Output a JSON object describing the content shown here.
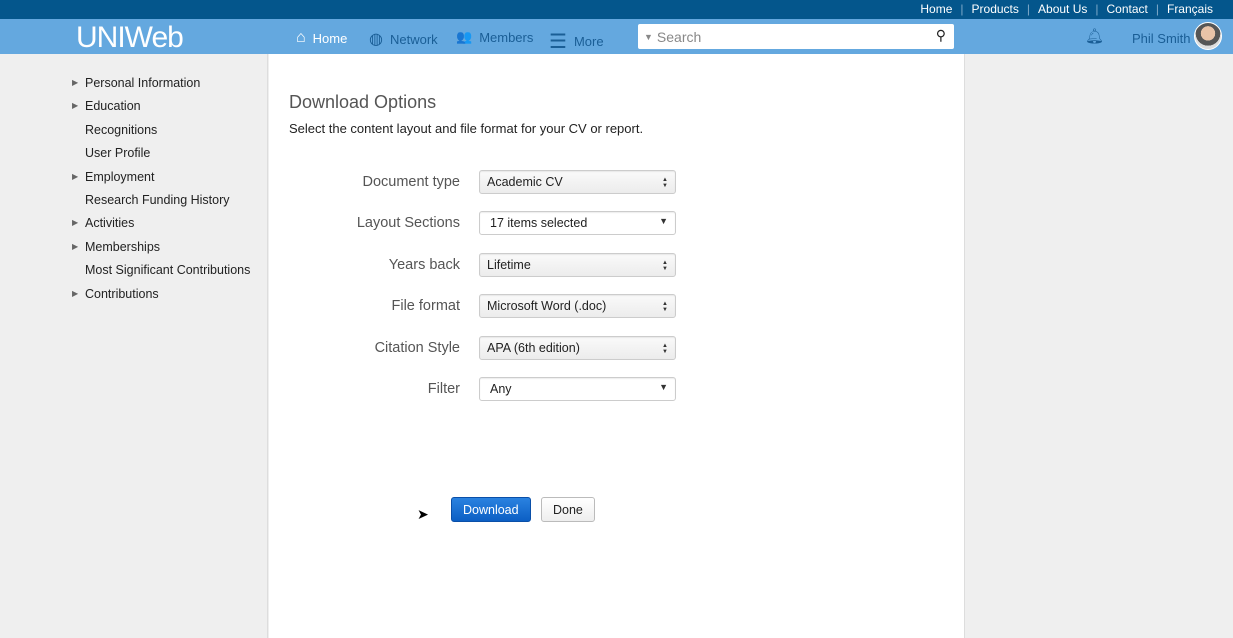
{
  "toplinks": [
    "Home",
    "Products",
    "About Us",
    "Contact",
    "Français"
  ],
  "logo": "UNIWeb",
  "nav": {
    "home": "Home",
    "network": "Network",
    "members": "Members",
    "more": "More"
  },
  "search": {
    "placeholder": "Search"
  },
  "user": {
    "name": "Phil Smith"
  },
  "sidebar": [
    {
      "label": "Personal Information",
      "expandable": true
    },
    {
      "label": "Education",
      "expandable": true
    },
    {
      "label": "Recognitions",
      "expandable": false
    },
    {
      "label": "User Profile",
      "expandable": false
    },
    {
      "label": "Employment",
      "expandable": true
    },
    {
      "label": "Research Funding History",
      "expandable": false
    },
    {
      "label": "Activities",
      "expandable": true
    },
    {
      "label": "Memberships",
      "expandable": true
    },
    {
      "label": "Most Significant Contributions",
      "expandable": false
    },
    {
      "label": "Contributions",
      "expandable": true
    }
  ],
  "main": {
    "title": "Download Options",
    "subtitle": "Select the content layout and file format for your CV or report.",
    "fields": [
      {
        "label": "Document type",
        "value": "Academic CV",
        "kind": "select"
      },
      {
        "label": "Layout Sections",
        "value": "17 items selected",
        "kind": "dropdown"
      },
      {
        "label": "Years back",
        "value": "Lifetime",
        "kind": "select"
      },
      {
        "label": "File format",
        "value": "Microsoft Word (.doc)",
        "kind": "select"
      },
      {
        "label": "Citation Style",
        "value": "APA (6th edition)",
        "kind": "select"
      },
      {
        "label": "Filter",
        "value": "Any",
        "kind": "dropdown"
      }
    ],
    "download": "Download",
    "done": "Done"
  }
}
